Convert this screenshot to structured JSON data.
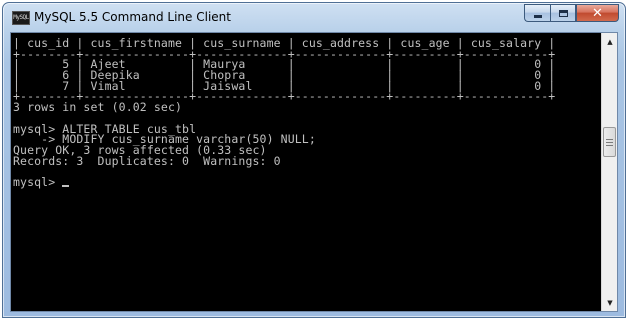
{
  "window": {
    "title": "MySQL 5.5 Command Line Client",
    "icon_label": "MySQL",
    "icon": "console-app-icon",
    "close_label": "✕"
  },
  "console": {
    "lines": [
      "| cus_id | cus_firstname | cus_surname | cus_address | cus_age | cus_salary |",
      "+--------+---------------+-------------+-------------+---------+------------+",
      "|      5 | Ajeet         | Maurya      |             |         |          0 |",
      "|      6 | Deepika       | Chopra      |             |         |          0 |",
      "|      7 | Vimal         | Jaiswal     |             |         |          0 |",
      "+--------+---------------+-------------+-------------+---------+------------+",
      "3 rows in set (0.02 sec)",
      "",
      "mysql> ALTER TABLE cus_tbl",
      "    -> MODIFY cus_surname varchar(50) NULL;",
      "Query OK, 3 rows affected (0.33 sec)",
      "Records: 3  Duplicates: 0  Warnings: 0",
      "",
      "mysql> "
    ]
  },
  "scrollbar": {
    "up_arrow": "▲",
    "down_arrow": "▼",
    "thumb_position": 0.36
  },
  "colors": {
    "console_bg": "#000000",
    "console_text": "#c0c0c0",
    "close_button": "#c04a2f"
  }
}
